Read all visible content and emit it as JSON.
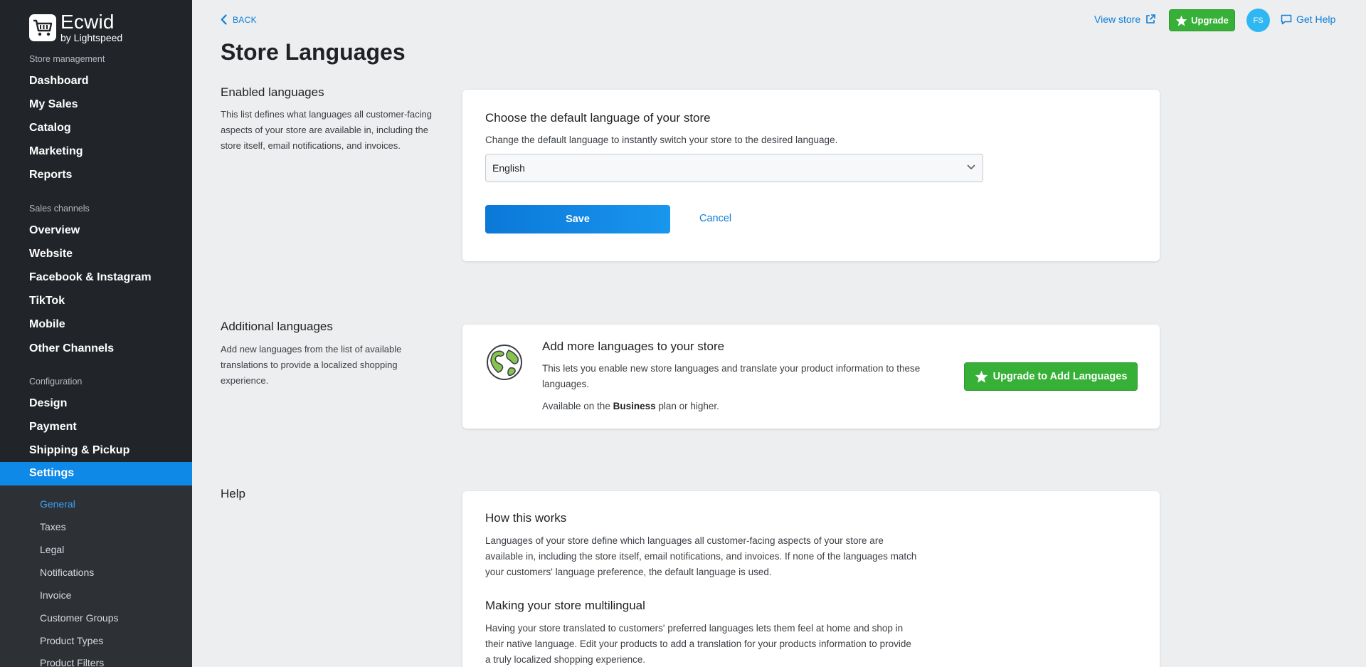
{
  "brand": {
    "name": "Ecwid",
    "sub": "by Lightspeed"
  },
  "sidebar": {
    "section_store": "Store management",
    "store_items": [
      "Dashboard",
      "My Sales",
      "Catalog",
      "Marketing",
      "Reports"
    ],
    "section_channels": "Sales channels",
    "channel_items": [
      "Overview",
      "Website",
      "Facebook & Instagram",
      "TikTok",
      "Mobile",
      "Other Channels"
    ],
    "section_config": "Configuration",
    "config_items": [
      "Design",
      "Payment",
      "Shipping & Pickup",
      "Settings"
    ],
    "settings_sub": [
      "General",
      "Taxes",
      "Legal",
      "Notifications",
      "Invoice",
      "Customer Groups",
      "Product Types",
      "Product Filters"
    ]
  },
  "header": {
    "back": "BACK",
    "title": "Store Languages",
    "view_store": "View store",
    "upgrade": "Upgrade",
    "avatar_initials": "FS",
    "get_help": "Get Help"
  },
  "enabled": {
    "title": "Enabled languages",
    "desc": "This list defines what languages all customer-facing aspects of your store are available in, including the store itself, email notifications, and invoices.",
    "card_title": "Choose the default language of your store",
    "card_text": "Change the default language to instantly switch your store to the desired language.",
    "selected_language": "English",
    "save": "Save",
    "cancel": "Cancel"
  },
  "additional": {
    "title": "Additional languages",
    "desc": "Add new languages from the list of available translations to provide a localized shopping experience.",
    "card_title": "Add more languages to your store",
    "card_text": "This lets you enable new store languages and translate your product information to these languages.",
    "avail_prefix": "Available on the ",
    "avail_plan": "Business",
    "avail_suffix": " plan or higher.",
    "button": "Upgrade to Add Languages"
  },
  "help": {
    "title": "Help",
    "h1": "How this works",
    "p1": "Languages of your store define which languages all customer-facing aspects of your store are available in, including the store itself, email notifications, and invoices. If none of the languages match your customers' language preference, the default language is used.",
    "h2": "Making your store multilingual",
    "p2": "Having your store translated to customers' preferred languages lets them feel at home and shop in their native language. Edit your products to add a translation for your products information to provide a truly localized shopping experience."
  },
  "colors": {
    "accent": "#0e89e8",
    "upgrade_green": "#36b037",
    "sidebar_bg": "#212529"
  },
  "icons": [
    "cart-logo-icon",
    "chevron-left-icon",
    "external-link-icon",
    "star-icon",
    "chat-icon",
    "chevron-down-icon",
    "globe-icon"
  ]
}
